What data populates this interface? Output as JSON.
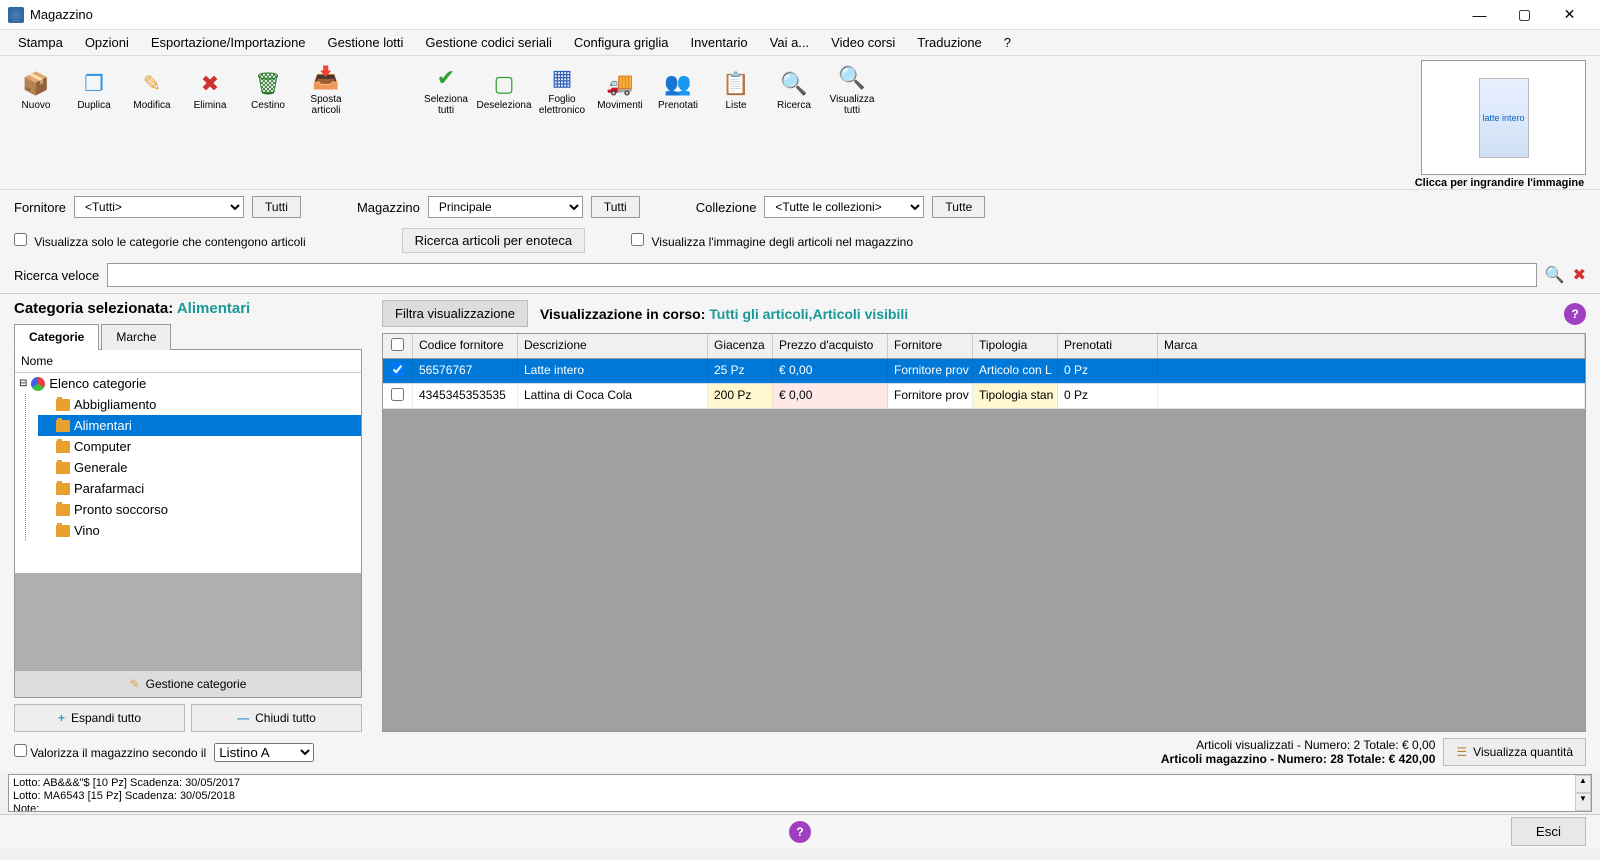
{
  "window": {
    "title": "Magazzino"
  },
  "menu": [
    "Stampa",
    "Opzioni",
    "Esportazione/Importazione",
    "Gestione lotti",
    "Gestione codici seriali",
    "Configura griglia",
    "Inventario",
    "Vai a...",
    "Video corsi",
    "Traduzione",
    "?"
  ],
  "toolbar": {
    "nuovo": "Nuovo",
    "duplica": "Duplica",
    "modifica": "Modifica",
    "elimina": "Elimina",
    "cestino": "Cestino",
    "sposta": "Sposta articoli",
    "seleziona": "Seleziona tutti",
    "deseleziona": "Deseleziona",
    "foglio": "Foglio elettronico",
    "movimenti": "Movimenti",
    "prenotati": "Prenotati",
    "liste": "Liste",
    "ricerca": "Ricerca",
    "visualizza": "Visualizza tutti"
  },
  "preview": {
    "label": "Clicca per ingrandire l'immagine",
    "product": "latte intero"
  },
  "filters": {
    "fornitore_label": "Fornitore",
    "fornitore_value": "<Tutti>",
    "fornitore_btn": "Tutti",
    "magazzino_label": "Magazzino",
    "magazzino_value": "Principale",
    "magazzino_btn": "Tutti",
    "collezione_label": "Collezione",
    "collezione_value": "<Tutte le collezioni>",
    "collezione_btn": "Tutte"
  },
  "options": {
    "visualizza_cat": "Visualizza solo le categorie che contengono articoli",
    "ricerca_enoteca": "Ricerca articoli per enoteca",
    "visualizza_img": "Visualizza l'immagine degli articoli nel magazzino"
  },
  "search": {
    "label": "Ricerca veloce",
    "value": ""
  },
  "categories": {
    "header_label": "Categoria selezionata:",
    "header_value": "Alimentari",
    "tab_cat": "Categorie",
    "tab_marche": "Marche",
    "col_nome": "Nome",
    "root": "Elenco categorie",
    "items": [
      "Abbigliamento",
      "Alimentari",
      "Computer",
      "Generale",
      "Parafarmaci",
      "Pronto soccorso",
      "Vino"
    ],
    "selected_index": 1,
    "gestione": "Gestione categorie",
    "espandi": "Espandi tutto",
    "chiudi": "Chiudi tutto"
  },
  "view": {
    "filter_btn": "Filtra visualizzazione",
    "label": "Visualizzazione in corso:",
    "value": "Tutti gli articoli,Articoli visibili"
  },
  "grid": {
    "columns": [
      "",
      "Codice fornitore",
      "Descrizione",
      "Giacenza",
      "Prezzo d'acquisto",
      "Fornitore",
      "Tipologia",
      "Prenotati",
      "Marca"
    ],
    "rows": [
      {
        "selected": true,
        "codice": "56576767",
        "descrizione": "Latte intero",
        "giacenza": "25 Pz",
        "prezzo": "€ 0,00",
        "fornitore": "Fornitore prov",
        "tipologia": "Articolo con L",
        "prenotati": "0 Pz",
        "marca": ""
      },
      {
        "selected": false,
        "codice": "4345345353535",
        "descrizione": "Lattina di Coca Cola",
        "giacenza": "200 Pz",
        "prezzo": "€ 0,00",
        "fornitore": "Fornitore prov",
        "tipologia": "Tipologia stan",
        "prenotati": "0 Pz",
        "marca": ""
      }
    ]
  },
  "footer": {
    "valorizza": "Valorizza il magazzino secondo il",
    "listino": "Listino A",
    "line1": "Articoli visualizzati - Numero: 2 Totale: € 0,00",
    "line2": "Articoli magazzino - Numero: 28 Totale: € 420,00",
    "qty_btn": "Visualizza quantità"
  },
  "lotto": {
    "line1": "Lotto: AB&&&\"$ [10 Pz] Scadenza: 30/05/2017",
    "line2": "Lotto: MA6543 [15 Pz] Scadenza: 30/05/2018",
    "line3": "Note:"
  },
  "esci": "Esci"
}
